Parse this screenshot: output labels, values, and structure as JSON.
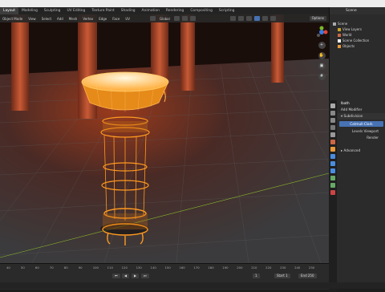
{
  "workspace_tabs": [
    "Layout",
    "Modeling",
    "Sculpting",
    "UV Editing",
    "Texture Paint",
    "Shading",
    "Animation",
    "Rendering",
    "Compositing",
    "Scripting"
  ],
  "active_tab": "Layout",
  "scene_name": "Scene",
  "viewport_header": {
    "menus": [
      "Object Mode",
      "View",
      "Select",
      "Add",
      "Mesh",
      "Vertex",
      "Edge",
      "Face",
      "UV"
    ],
    "orientation": "Global",
    "options_label": "Options"
  },
  "outliner": {
    "rows": [
      {
        "label": "Scene",
        "indent": 0
      },
      {
        "label": "View Layers",
        "indent": 1
      },
      {
        "label": "World",
        "indent": 1
      },
      {
        "label": "Scene Collection",
        "indent": 1
      },
      {
        "label": "Objects",
        "indent": 1
      }
    ]
  },
  "properties": {
    "object_name": "lbath",
    "add_modifier_label": "Add Modifier",
    "modifier_name": "Subdivision",
    "modifier_type_button": "Catmull-Clark",
    "fields": [
      {
        "label": "Levels Viewport"
      },
      {
        "label": "Render"
      }
    ],
    "advanced_label": "Advanced"
  },
  "timeline": {
    "ticks": [
      "40",
      "50",
      "60",
      "70",
      "80",
      "90",
      "100",
      "110",
      "120",
      "130",
      "140",
      "150",
      "160",
      "170",
      "180",
      "190",
      "200",
      "210",
      "220",
      "230",
      "240",
      "250"
    ],
    "current_frame": "1",
    "start_label": "Start",
    "start_value": "1",
    "end_label": "End",
    "end_value": "250"
  },
  "colors": {
    "accent": "#4772b3",
    "selection_orange": "#ff9a1f",
    "floor_glow": "#7a2a14"
  }
}
